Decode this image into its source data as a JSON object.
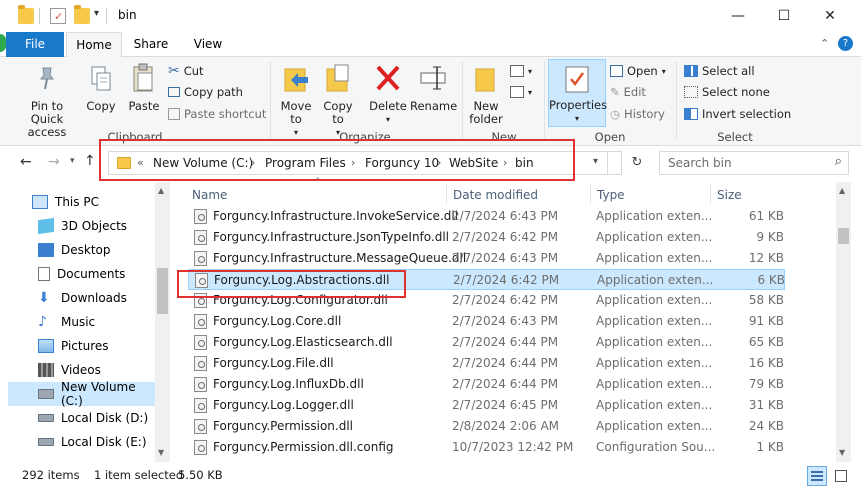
{
  "window": {
    "title": "bin",
    "minimize_glyph": "—",
    "maximize_glyph": "☐",
    "close_glyph": "✕",
    "help_glyph": "?",
    "collapse_glyph": "⌃"
  },
  "tabs": {
    "file": "File",
    "home": "Home",
    "share": "Share",
    "view": "View"
  },
  "ribbon": {
    "clipboard": {
      "pin_label": "Pin to Quick access",
      "copy_label": "Copy",
      "paste_label": "Paste",
      "cut_label": "Cut",
      "copy_path_label": "Copy path",
      "paste_shortcut_label": "Paste shortcut",
      "group_label": "Clipboard"
    },
    "organize": {
      "move_to_label": "Move to",
      "copy_to_label": "Copy to",
      "delete_label": "Delete",
      "rename_label": "Rename",
      "group_label": "Organize"
    },
    "new": {
      "new_folder_label": "New folder",
      "group_label": "New"
    },
    "open": {
      "properties_label": "Properties",
      "open_label": "Open",
      "edit_label": "Edit",
      "history_label": "History",
      "group_label": "Open"
    },
    "select": {
      "select_all_label": "Select all",
      "select_none_label": "Select none",
      "invert_label": "Invert selection",
      "group_label": "Select"
    }
  },
  "address": {
    "overflow": "«",
    "crumbs": [
      "New Volume (C:)",
      "Program Files",
      "Forguncy 10",
      "WebSite",
      "bin"
    ],
    "separator": "›",
    "search_placeholder": "Search bin"
  },
  "nav": {
    "items": [
      {
        "label": "This PC",
        "icon": "computer-icon"
      },
      {
        "label": "3D Objects",
        "icon": "3d-objects-icon"
      },
      {
        "label": "Desktop",
        "icon": "desktop-icon"
      },
      {
        "label": "Documents",
        "icon": "documents-icon"
      },
      {
        "label": "Downloads",
        "icon": "downloads-icon"
      },
      {
        "label": "Music",
        "icon": "music-icon"
      },
      {
        "label": "Pictures",
        "icon": "pictures-icon"
      },
      {
        "label": "Videos",
        "icon": "videos-icon"
      },
      {
        "label": "New Volume (C:)",
        "icon": "drive-icon"
      },
      {
        "label": "Local Disk (D:)",
        "icon": "drive-icon"
      },
      {
        "label": "Local Disk (E:)",
        "icon": "drive-icon"
      }
    ]
  },
  "list": {
    "columns": {
      "name": "Name",
      "date": "Date modified",
      "type": "Type",
      "size": "Size"
    },
    "rows": [
      {
        "name": "Forguncy.Infrastructure.InvokeService.dll",
        "date": "2/7/2024 6:43 PM",
        "type": "Application exten...",
        "size": "61 KB"
      },
      {
        "name": "Forguncy.Infrastructure.JsonTypeInfo.dll",
        "date": "2/7/2024 6:42 PM",
        "type": "Application exten...",
        "size": "9 KB"
      },
      {
        "name": "Forguncy.Infrastructure.MessageQueue.dll",
        "date": "2/7/2024 6:43 PM",
        "type": "Application exten...",
        "size": "12 KB"
      },
      {
        "name": "Forguncy.Log.Abstractions.dll",
        "date": "2/7/2024 6:42 PM",
        "type": "Application exten...",
        "size": "6 KB"
      },
      {
        "name": "Forguncy.Log.Configurator.dll",
        "date": "2/7/2024 6:42 PM",
        "type": "Application exten...",
        "size": "58 KB"
      },
      {
        "name": "Forguncy.Log.Core.dll",
        "date": "2/7/2024 6:43 PM",
        "type": "Application exten...",
        "size": "91 KB"
      },
      {
        "name": "Forguncy.Log.Elasticsearch.dll",
        "date": "2/7/2024 6:44 PM",
        "type": "Application exten...",
        "size": "65 KB"
      },
      {
        "name": "Forguncy.Log.File.dll",
        "date": "2/7/2024 6:44 PM",
        "type": "Application exten...",
        "size": "16 KB"
      },
      {
        "name": "Forguncy.Log.InfluxDb.dll",
        "date": "2/7/2024 6:44 PM",
        "type": "Application exten...",
        "size": "79 KB"
      },
      {
        "name": "Forguncy.Log.Logger.dll",
        "date": "2/7/2024 6:45 PM",
        "type": "Application exten...",
        "size": "31 KB"
      },
      {
        "name": "Forguncy.Permission.dll",
        "date": "2/8/2024 2:06 AM",
        "type": "Application exten...",
        "size": "24 KB"
      },
      {
        "name": "Forguncy.Permission.dll.config",
        "date": "10/7/2023 12:42 PM",
        "type": "Configuration Sou...",
        "size": "1 KB"
      }
    ]
  },
  "status": {
    "item_count": "292 items",
    "selection": "1 item selected",
    "selection_size": "5.50 KB"
  },
  "colors": {
    "accent": "#1979ca",
    "selection": "#cce8ff",
    "highlight_rect": "#e03131"
  }
}
